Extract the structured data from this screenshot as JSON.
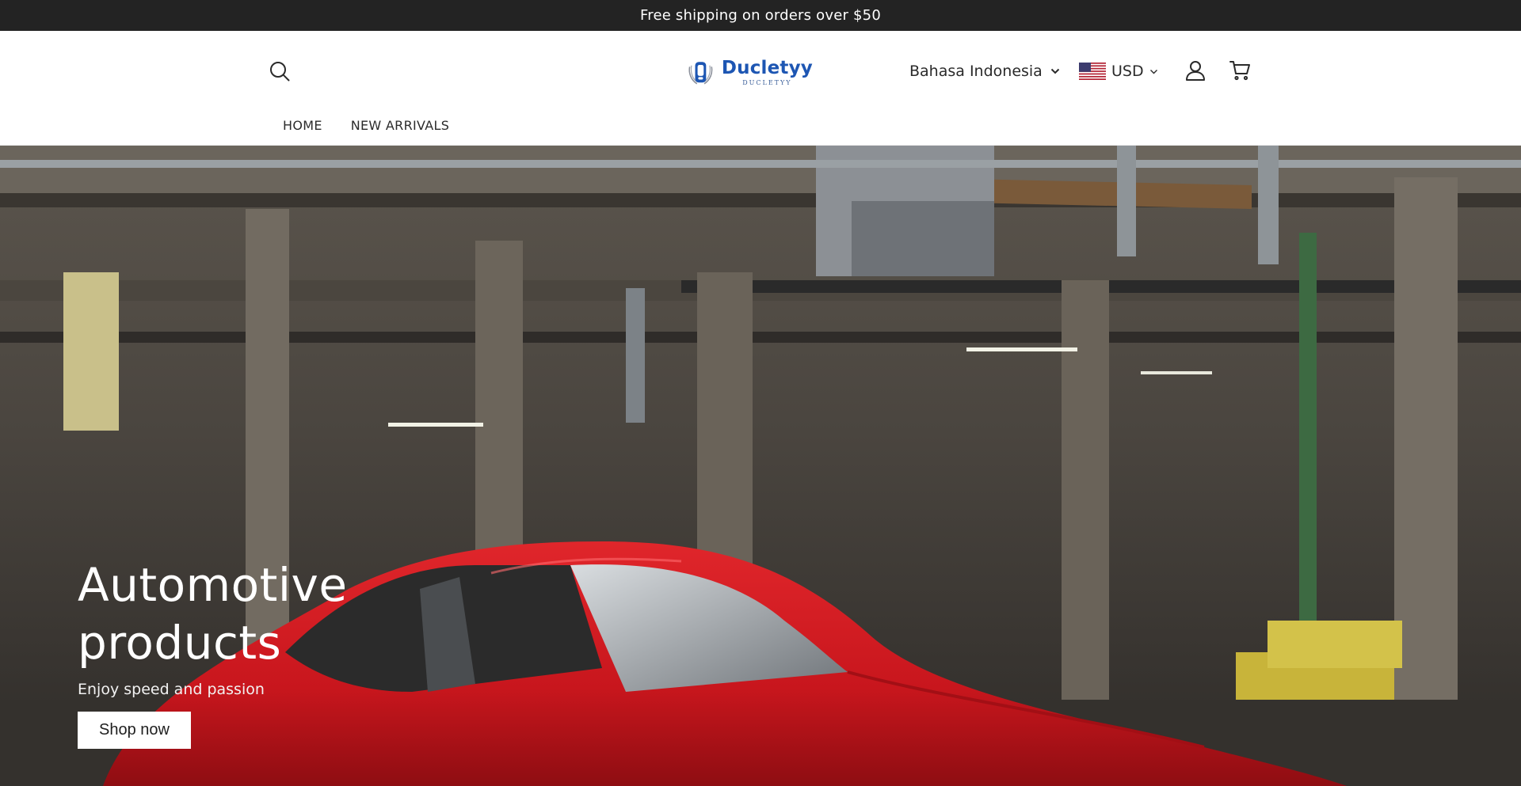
{
  "announcement": {
    "text": "Free shipping on orders over $50"
  },
  "header": {
    "search_icon": "search-icon",
    "logo": {
      "title": "Ducletyy",
      "subtitle": "DUCLETYY",
      "brand_color": "#1d56b3"
    },
    "language": {
      "selected": "Bahasa Indonesia",
      "icon": "chevron-down-icon"
    },
    "currency": {
      "selected": "USD",
      "flag": "us-flag-icon",
      "icon": "chevron-down-icon"
    },
    "account_icon": "user-icon",
    "cart_icon": "cart-icon"
  },
  "nav": {
    "items": [
      {
        "label": "HOME"
      },
      {
        "label": "NEW ARRIVALS"
      }
    ]
  },
  "hero": {
    "title_line1": "Automotive",
    "title_line2": "products",
    "subtitle": "Enjoy speed and passion",
    "button_label": "Shop now",
    "image": "red vintage sports car in an abandoned industrial garage"
  },
  "colors": {
    "announcement_bg": "#232323",
    "header_bg": "#ffffff",
    "accent": "#1d56b3",
    "car_red": "#c8161d"
  }
}
